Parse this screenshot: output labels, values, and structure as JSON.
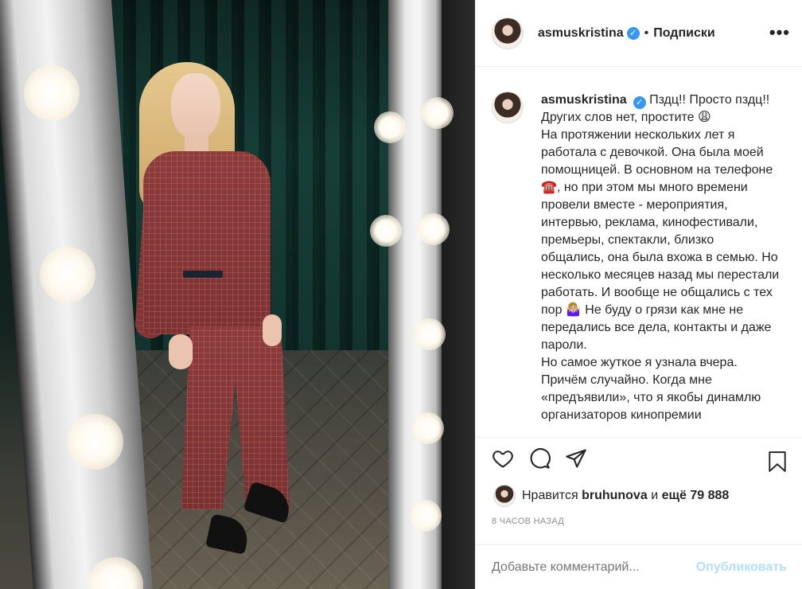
{
  "post": {
    "username": "asmuskristina",
    "separator": "•",
    "follow_label": "Подписки",
    "more_icon": "more-options-icon",
    "verified_mark": "✓"
  },
  "caption": {
    "username": "asmuskristina",
    "text": "Пздц!! Просто пздц!! Других слов нет, простите 😩\nНа протяжении нескольких лет я работала с девочкой. Она была моей помощницей. В основном на телефоне ☎️, но при этом мы много времени провели вместе - мероприятия, интервью, реклама, кинофестивали, премьеры, спектакли, близко общались, она была вхожа в семью. Но несколько месяцев назад мы перестали работать. И вообще не общались с тех пор 🤷🏼‍♀️ Не буду о грязи как мне не передались все дела, контакты и даже пароли.\nНо самое жуткое я узнала вчера. Причём случайно. Когда мне «предъявили», что я якобы динамлю организаторов кинопремии"
  },
  "actions": {
    "like_icon": "heart-icon",
    "comment_icon": "comment-icon",
    "share_icon": "share-icon",
    "save_icon": "bookmark-icon"
  },
  "likes": {
    "prefix": "Нравится",
    "user": "bruhunova",
    "joiner": "и",
    "count_text": "ещё 79 888"
  },
  "timestamp": "8 ЧАСОВ НАЗАД",
  "comment": {
    "placeholder": "Добавьте комментарий...",
    "post_label": "Опубликовать"
  },
  "colors": {
    "accent": "#3897f0",
    "post_disabled": "#b2dffc",
    "muted": "#8e8e8e",
    "text": "#262626"
  }
}
